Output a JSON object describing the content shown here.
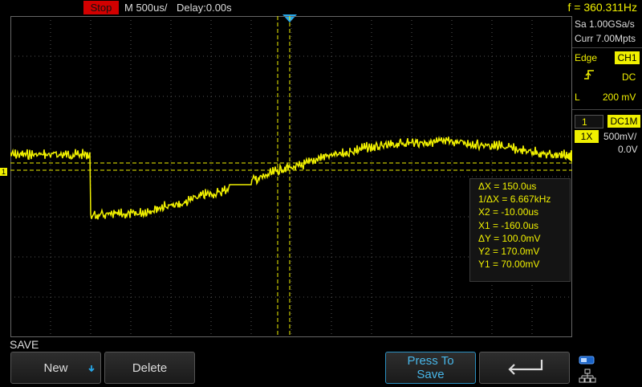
{
  "top_bar": {
    "run_state": "Stop",
    "timebase": "M 500us/",
    "delay": "Delay:0.00s",
    "frequency": "f = 360.311Hz"
  },
  "acquisition": {
    "sample_rate": "Sa 1.00GSa/s",
    "memory_depth": "Curr 7.00Mpts"
  },
  "trigger": {
    "type": "Edge",
    "source": "CH1",
    "coupling": "DC",
    "level_label": "L",
    "level": "200 mV"
  },
  "channel": {
    "number": "1",
    "coupling": "DC1M",
    "probe": "1X",
    "scale": "500mV/",
    "offset": "0.0V",
    "marker": "1"
  },
  "cursors": {
    "delta_x": "ΔX = 150.0us",
    "inv_delta_x": "1/ΔX = 6.667kHz",
    "x2": "X2 = -10.00us",
    "x1": "X1 = -160.0us",
    "delta_y": "ΔY = 100.0mV",
    "y2": "Y2 = 170.0mV",
    "y1": "Y1 = 70.00mV"
  },
  "menu": {
    "title": "SAVE",
    "new_label": "New",
    "delete_label": "Delete",
    "press_to_label": "Press To",
    "save_label": "Save"
  },
  "colors": {
    "trace": "#f0f000",
    "accent": "#27a7e8",
    "stop": "#d20000"
  },
  "waveform": {
    "description_points_mV": [
      [
        -2.5,
        -600
      ],
      [
        -2.0,
        -580
      ],
      [
        -1.5,
        -480
      ],
      [
        -1.0,
        -330
      ],
      [
        -0.5,
        -150
      ],
      [
        0.0,
        0
      ],
      [
        0.5,
        150
      ],
      [
        1.0,
        250
      ],
      [
        1.5,
        310
      ],
      [
        2.0,
        320
      ],
      [
        2.5,
        270
      ],
      [
        3.0,
        200
      ],
      [
        3.2,
        160
      ]
    ]
  }
}
